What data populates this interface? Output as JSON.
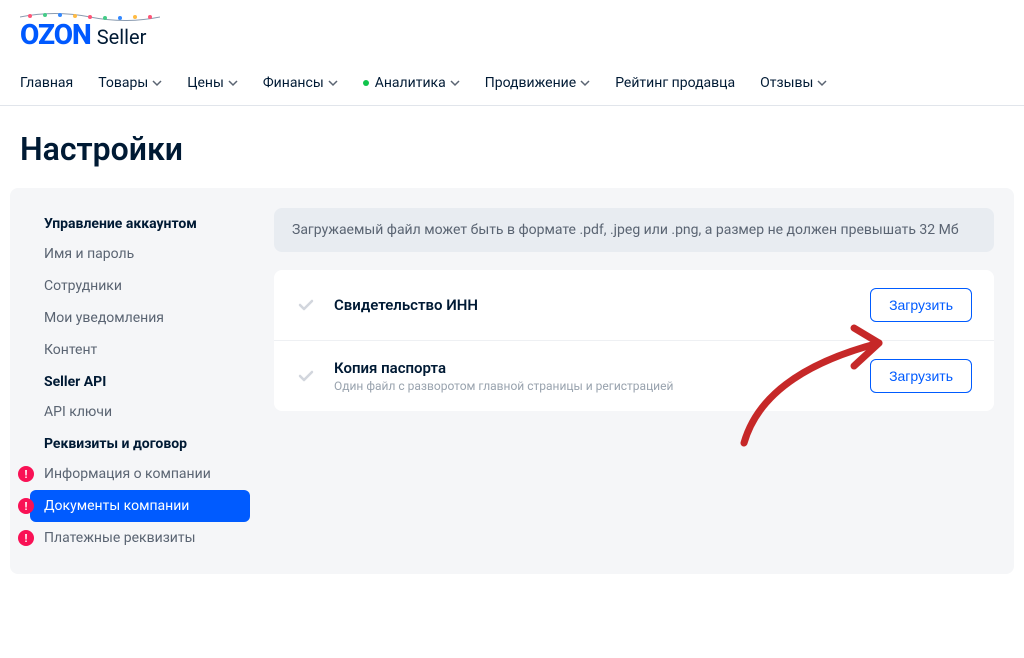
{
  "logo": {
    "ozon": "OZON",
    "seller": "Seller"
  },
  "nav": {
    "items": [
      {
        "label": "Главная",
        "dropdown": false,
        "dot": false
      },
      {
        "label": "Товары",
        "dropdown": true,
        "dot": false
      },
      {
        "label": "Цены",
        "dropdown": true,
        "dot": false
      },
      {
        "label": "Финансы",
        "dropdown": true,
        "dot": false
      },
      {
        "label": "Аналитика",
        "dropdown": true,
        "dot": true
      },
      {
        "label": "Продвижение",
        "dropdown": true,
        "dot": false
      },
      {
        "label": "Рейтинг продавца",
        "dropdown": false,
        "dot": false
      },
      {
        "label": "Отзывы",
        "dropdown": true,
        "dot": false
      }
    ]
  },
  "page_title": "Настройки",
  "sidebar": {
    "groups": [
      {
        "title": "Управление аккаунтом",
        "items": [
          {
            "label": "Имя и пароль",
            "alert": false,
            "active": false
          },
          {
            "label": "Сотрудники",
            "alert": false,
            "active": false
          },
          {
            "label": "Мои уведомления",
            "alert": false,
            "active": false
          },
          {
            "label": "Контент",
            "alert": false,
            "active": false
          }
        ]
      },
      {
        "title": "Seller API",
        "items": [
          {
            "label": "API ключи",
            "alert": false,
            "active": false
          }
        ]
      },
      {
        "title": "Реквизиты и договор",
        "items": [
          {
            "label": "Информация о компании",
            "alert": true,
            "active": false
          },
          {
            "label": "Документы компании",
            "alert": true,
            "active": true
          },
          {
            "label": "Платежные реквизиты",
            "alert": true,
            "active": false
          }
        ]
      }
    ]
  },
  "info_banner": "Загружаемый файл может быть в формате .pdf, .jpeg или .png, а размер не должен превышать 32 Мб",
  "uploads": [
    {
      "title": "Свидетельство ИНН",
      "subtitle": "",
      "button": "Загрузить"
    },
    {
      "title": "Копия паспорта",
      "subtitle": "Один файл с разворотом главной страницы и регистрацией",
      "button": "Загрузить"
    }
  ]
}
